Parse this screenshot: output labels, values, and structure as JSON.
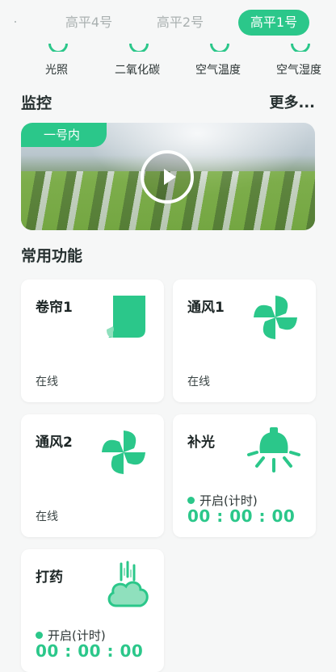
{
  "tabs": [
    {
      "label": "高平4号",
      "active": false
    },
    {
      "label": "高平2号",
      "active": false
    },
    {
      "label": "高平1号",
      "active": true
    }
  ],
  "sensors": [
    {
      "label": "光照",
      "icon": "light-sensor-icon"
    },
    {
      "label": "二氧化碳",
      "icon": "co2-sensor-icon"
    },
    {
      "label": "空气温度",
      "icon": "air-temperature-icon"
    },
    {
      "label": "空气湿度",
      "icon": "air-humidity-icon"
    }
  ],
  "monitor": {
    "title": "监控",
    "more": "更多...",
    "camera_label": "一号内",
    "play_icon": "play-icon"
  },
  "functions": {
    "title": "常用功能",
    "cards": [
      {
        "name": "卷帘1",
        "status": "在线",
        "icon": "roller-blind-icon"
      },
      {
        "name": "通风1",
        "status": "在线",
        "icon": "fan-icon"
      },
      {
        "name": "通风2",
        "status": "在线",
        "icon": "fan-icon"
      },
      {
        "name": "补光",
        "run_label": "开启(计时)",
        "timer": "00 : 00 : 00",
        "icon": "grow-light-icon"
      },
      {
        "name": "打药",
        "run_label": "开启(计时)",
        "timer": "00 : 00 : 00",
        "icon": "spray-icon"
      }
    ]
  },
  "colors": {
    "accent": "#2bc78a",
    "background": "#f6f7f7"
  }
}
